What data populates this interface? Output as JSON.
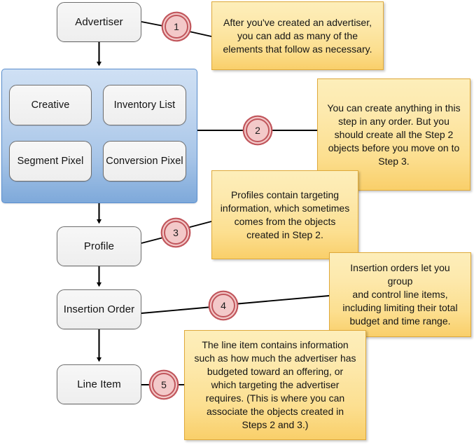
{
  "diagram": {
    "title": "Advertiser object creation order",
    "colors": {
      "node_fill": "#f2f2f2",
      "node_border": "#6e6e6e",
      "group_fill_top": "#cfe0f4",
      "group_fill_bottom": "#7ea9da",
      "group_border": "#5b8fce",
      "callout_fill_top": "#fdeeba",
      "callout_fill_bottom": "#f9cf6a",
      "callout_border": "#dfa93a",
      "badge_fill": "#f3c9c9",
      "badge_ring": "#c1565c",
      "connector": "#000000"
    },
    "nodes": {
      "advertiser": "Advertiser",
      "profile": "Profile",
      "insertion_order": "Insertion Order",
      "line_item": "Line Item"
    },
    "group": {
      "items": [
        "Creative",
        "Inventory List",
        "Segment Pixel",
        "Conversion Pixel"
      ]
    },
    "badges": [
      {
        "number": "1"
      },
      {
        "number": "2"
      },
      {
        "number": "3"
      },
      {
        "number": "4"
      },
      {
        "number": "5"
      }
    ],
    "callouts": [
      {
        "id": "callout-1",
        "text": "After you've created an advertiser,\nyou can add as many of the\nelements that follow as necessary."
      },
      {
        "id": "callout-2",
        "text": "You can create anything in this\nstep in any order. But you\nshould create all the Step 2\nobjects before you move on to\nStep 3."
      },
      {
        "id": "callout-3",
        "text": "Profiles contain targeting\ninformation, which sometimes\ncomes from the objects\ncreated in Step 2."
      },
      {
        "id": "callout-4",
        "text": "Insertion orders let you group\nand control line items,\nincluding limiting their total\nbudget and time range."
      },
      {
        "id": "callout-5",
        "text": "The line item contains information\nsuch as how much the advertiser has\nbudgeted toward an offering, or\nwhich targeting the advertiser\nrequires. (This is where you can\nassociate the objects created in\nSteps 2 and 3.)"
      }
    ]
  }
}
